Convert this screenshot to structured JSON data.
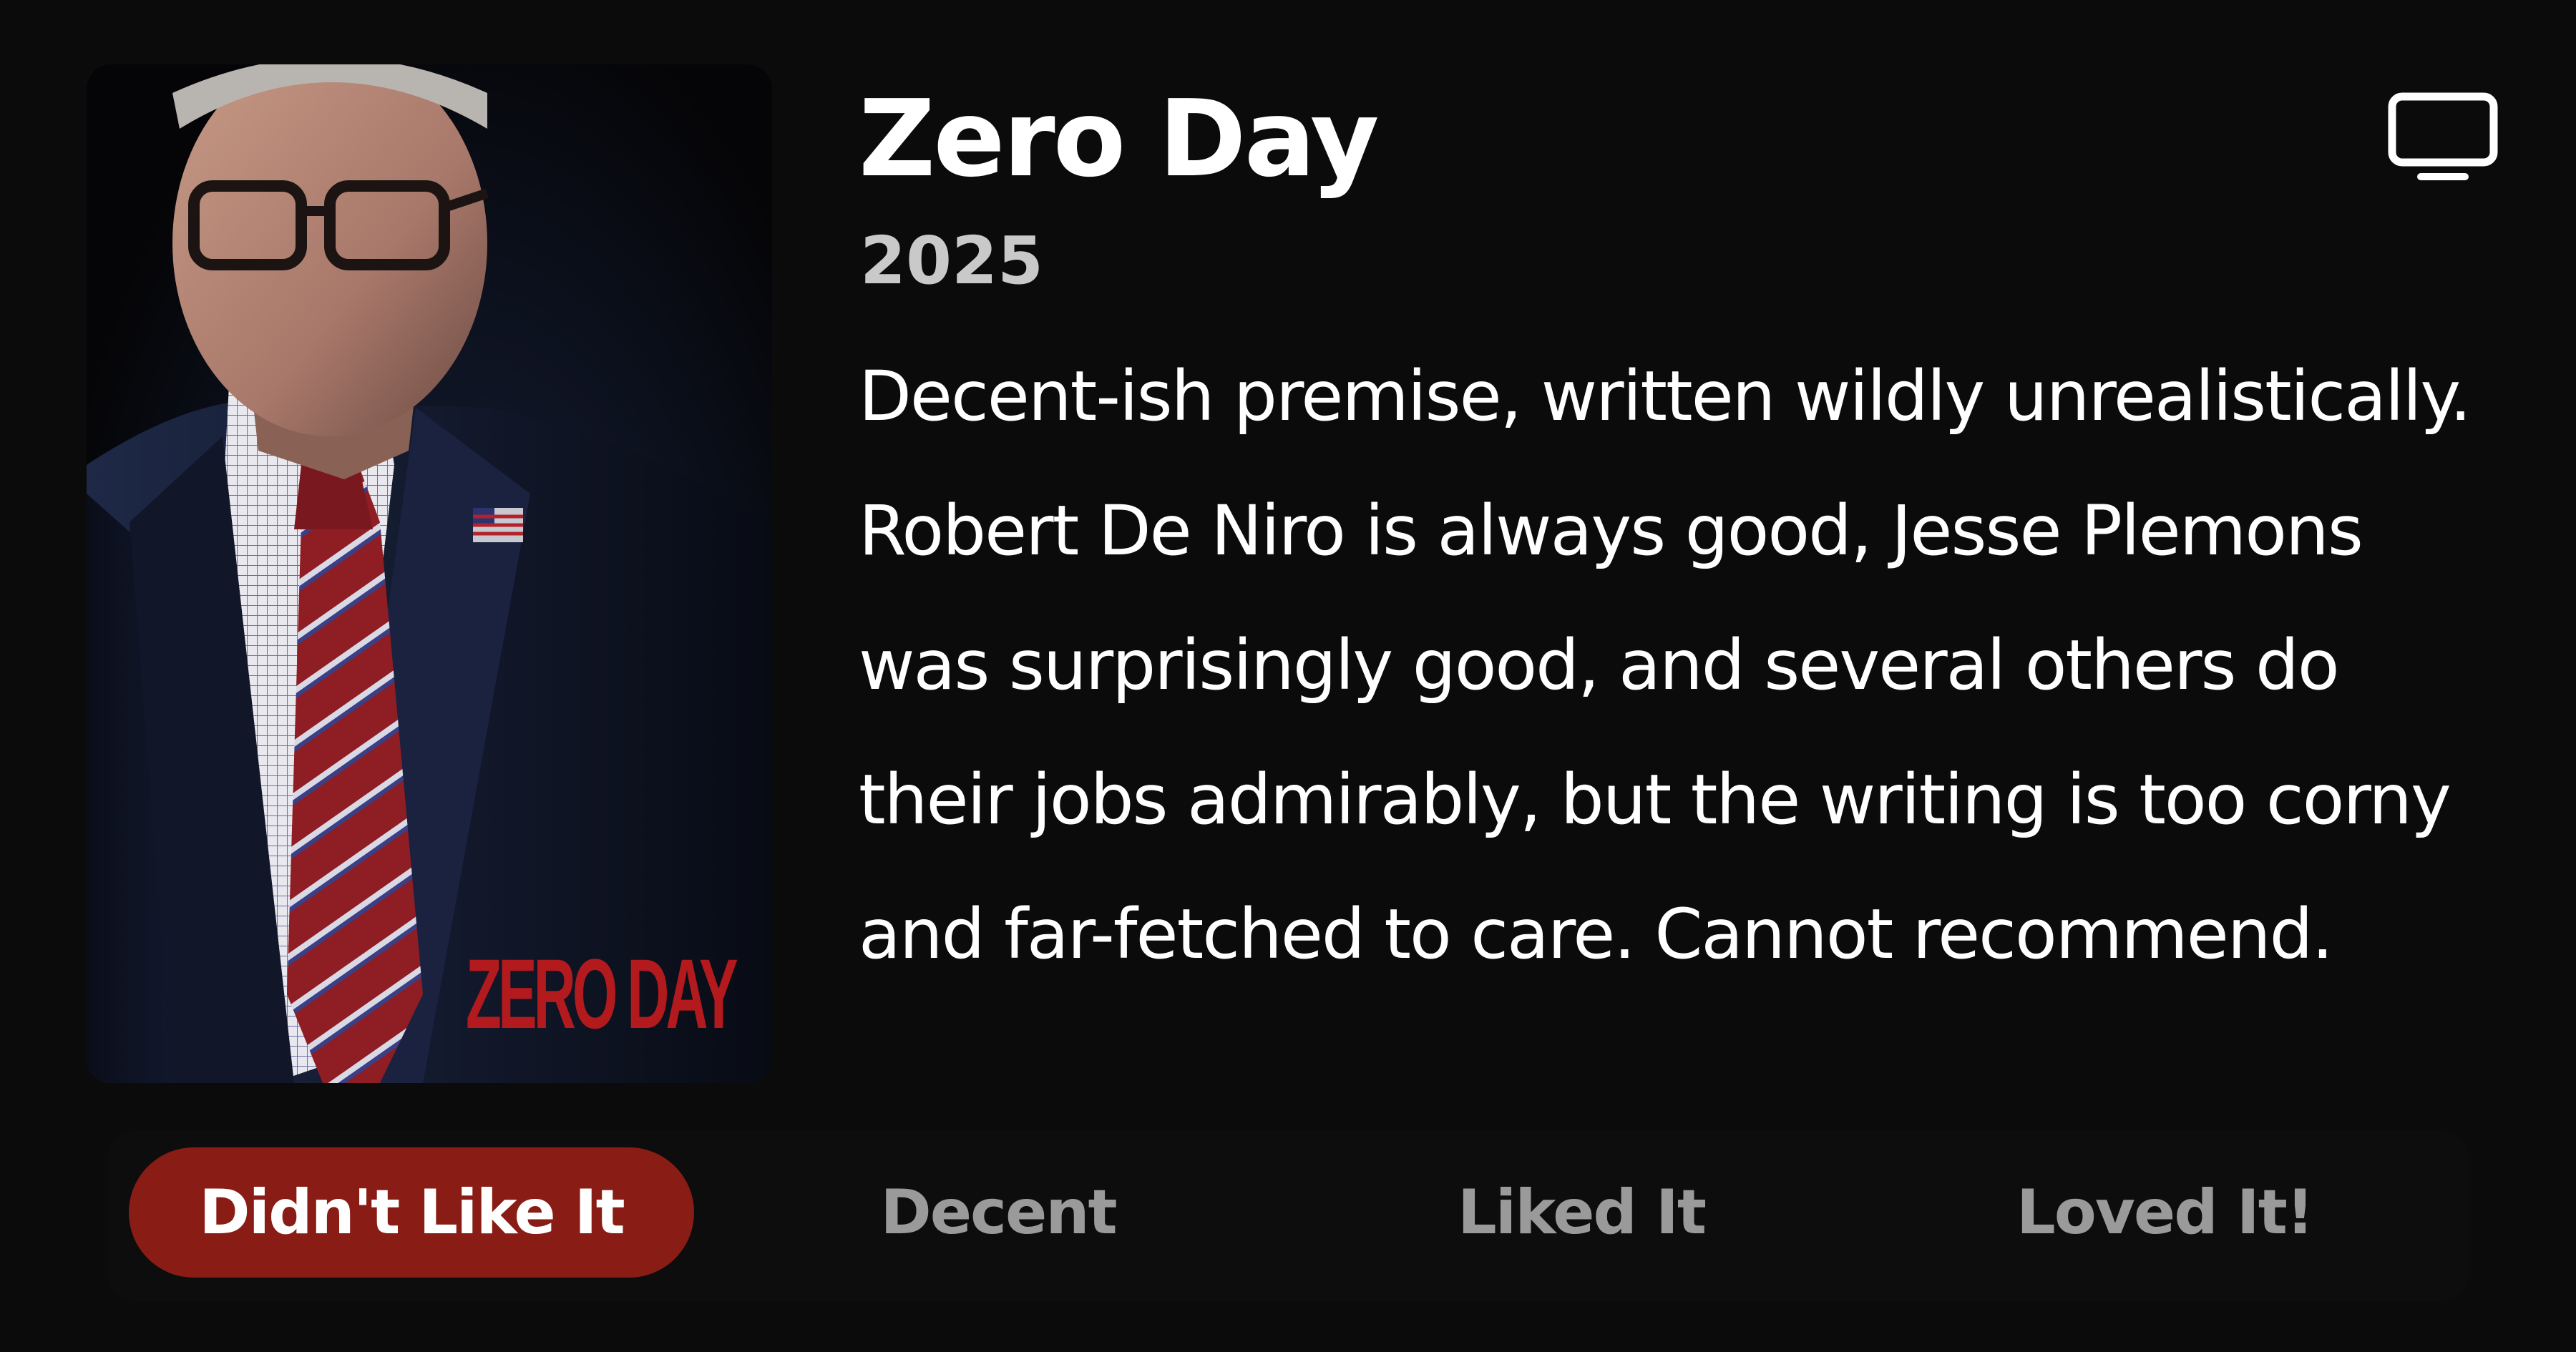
{
  "poster": {
    "title_text": "ZERO DAY"
  },
  "show": {
    "title": "Zero Day",
    "year": "2025",
    "review_lines": [
      "Decent-ish premise, written wildly unrealistically.",
      "Robert De Niro is always good, Jesse Plemons",
      "was surprisingly good, and several others do",
      "their jobs admirably, but the writing is too corny",
      "and far-fetched to care. Cannot recommend."
    ]
  },
  "icons": {
    "media_type": "tv-icon"
  },
  "rating": {
    "options": [
      "Didn't Like It",
      "Decent",
      "Liked It",
      "Loved It!"
    ],
    "selected_index": 0
  },
  "colors": {
    "background": "#0c0b0c",
    "selected": "#891d15",
    "unselected_text": "#9a9a9a",
    "poster_title": "#b21a1e"
  }
}
